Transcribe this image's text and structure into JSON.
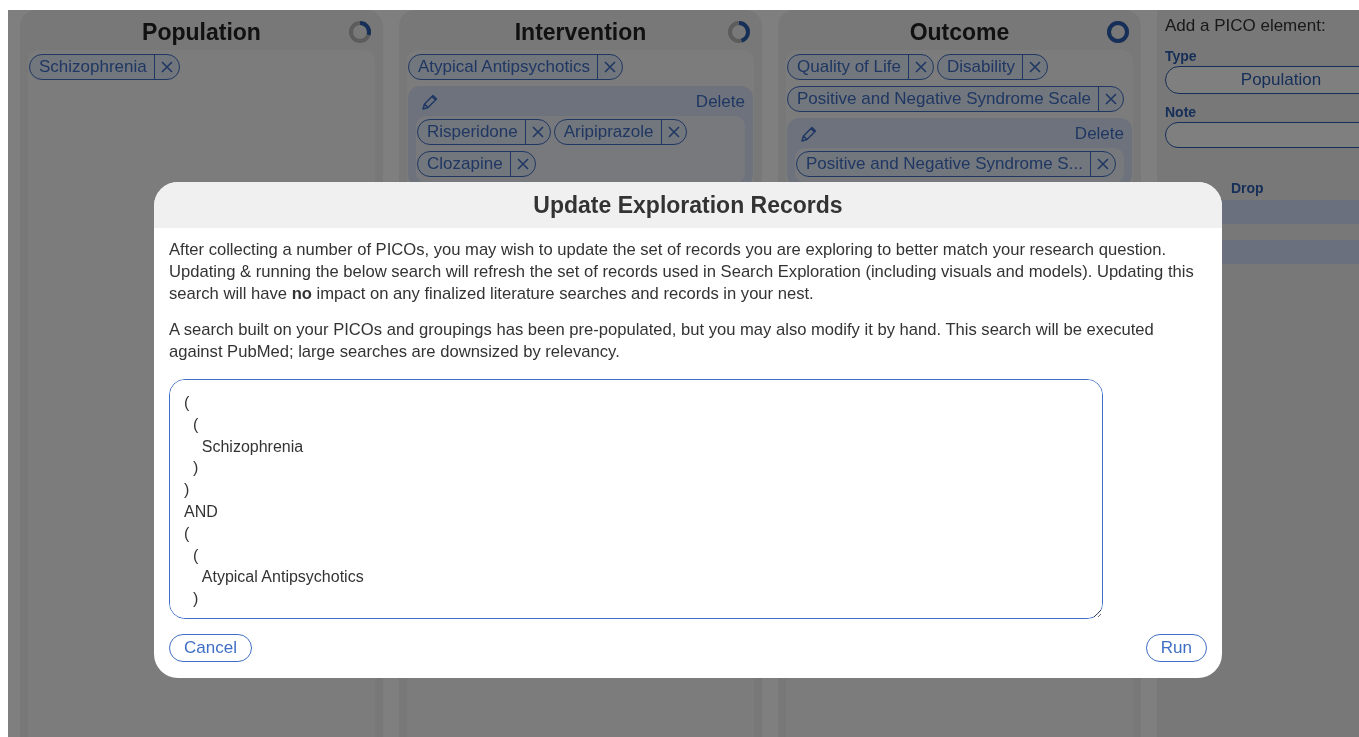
{
  "columns": [
    {
      "title": "Population",
      "level": 0.3,
      "chips": [
        {
          "label": "Schizophrenia"
        }
      ]
    },
    {
      "title": "Intervention",
      "level": 0.45,
      "chips": [
        {
          "label": "Atypical Antipsychotics"
        }
      ],
      "groups": [
        {
          "delete_label": "Delete",
          "chips": [
            {
              "label": "Risperidone"
            },
            {
              "label": "Aripiprazole"
            },
            {
              "label": "Clozapine"
            }
          ]
        }
      ]
    },
    {
      "title": "Outcome",
      "level": 1,
      "chips": [
        {
          "label": "Quality of Life"
        },
        {
          "label": "Disability"
        },
        {
          "label": "Positive and Negative Syndrome Scale"
        }
      ],
      "groups": [
        {
          "delete_label": "Delete",
          "chips": [
            {
              "label": "Positive and Negative Syndrome S..."
            }
          ]
        }
      ]
    }
  ],
  "add_panel": {
    "heading": "Add a PICO element:",
    "type_label": "Type",
    "type_value": "Population",
    "note_label": "Note",
    "drop_label": "Drop"
  },
  "dialog": {
    "title": "Update Exploration Records",
    "paragraphs": [
      "After collecting a number of PICOs, you may wish to update the set of records you are exploring to better match your research question. Updating & running the below search will refresh the set of records used in Search Exploration (including visuals and models). Updating this search will have **no** impact on any finalized literature searches and records in your nest.",
      "A search built on your PICOs and groupings has been pre-populated, but you may also modify it by hand. This search will be executed against PubMed; large searches are downsized by relevancy."
    ],
    "query": "(\n  (\n    Schizophrenia\n  )\n)\nAND\n(\n  (\n    Atypical Antipsychotics\n  )",
    "cancel_label": "Cancel",
    "run_label": "Run"
  }
}
